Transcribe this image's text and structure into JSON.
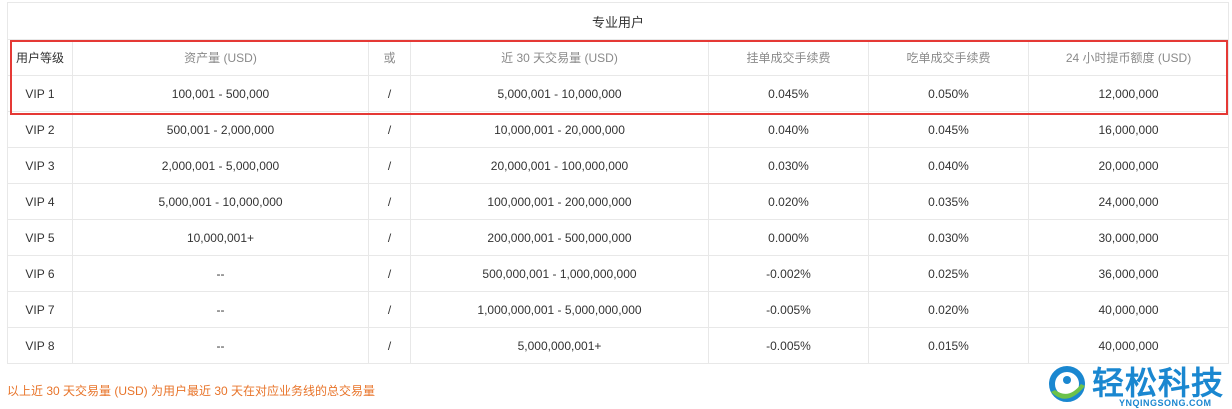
{
  "table": {
    "title": "专业用户",
    "headers": [
      "用户等级",
      "资产量 (USD)",
      "或",
      "近 30 天交易量 (USD)",
      "挂单成交手续费",
      "吃单成交手续费",
      "24 小时提币额度 (USD)"
    ],
    "rows": [
      [
        "VIP 1",
        "100,001 - 500,000",
        "/",
        "5,000,001 - 10,000,000",
        "0.045%",
        "0.050%",
        "12,000,000"
      ],
      [
        "VIP 2",
        "500,001 - 2,000,000",
        "/",
        "10,000,001 - 20,000,000",
        "0.040%",
        "0.045%",
        "16,000,000"
      ],
      [
        "VIP 3",
        "2,000,001 - 5,000,000",
        "/",
        "20,000,001 - 100,000,000",
        "0.030%",
        "0.040%",
        "20,000,000"
      ],
      [
        "VIP 4",
        "5,000,001 - 10,000,000",
        "/",
        "100,000,001 - 200,000,000",
        "0.020%",
        "0.035%",
        "24,000,000"
      ],
      [
        "VIP 5",
        "10,000,001+",
        "/",
        "200,000,001 - 500,000,000",
        "0.000%",
        "0.030%",
        "30,000,000"
      ],
      [
        "VIP 6",
        "--",
        "/",
        "500,000,001 - 1,000,000,000",
        "-0.002%",
        "0.025%",
        "36,000,000"
      ],
      [
        "VIP 7",
        "--",
        "/",
        "1,000,000,001 - 5,000,000,000",
        "-0.005%",
        "0.020%",
        "40,000,000"
      ],
      [
        "VIP 8",
        "--",
        "/",
        "5,000,000,001+",
        "-0.005%",
        "0.015%",
        "40,000,000"
      ]
    ]
  },
  "footnote": "以上近 30 天交易量 (USD) 为用户最近 30 天在对应业务线的总交易量",
  "watermark": {
    "text": "轻松科技",
    "subtext": "YNQINGSONG.COM",
    "color": "#1a87d0"
  }
}
